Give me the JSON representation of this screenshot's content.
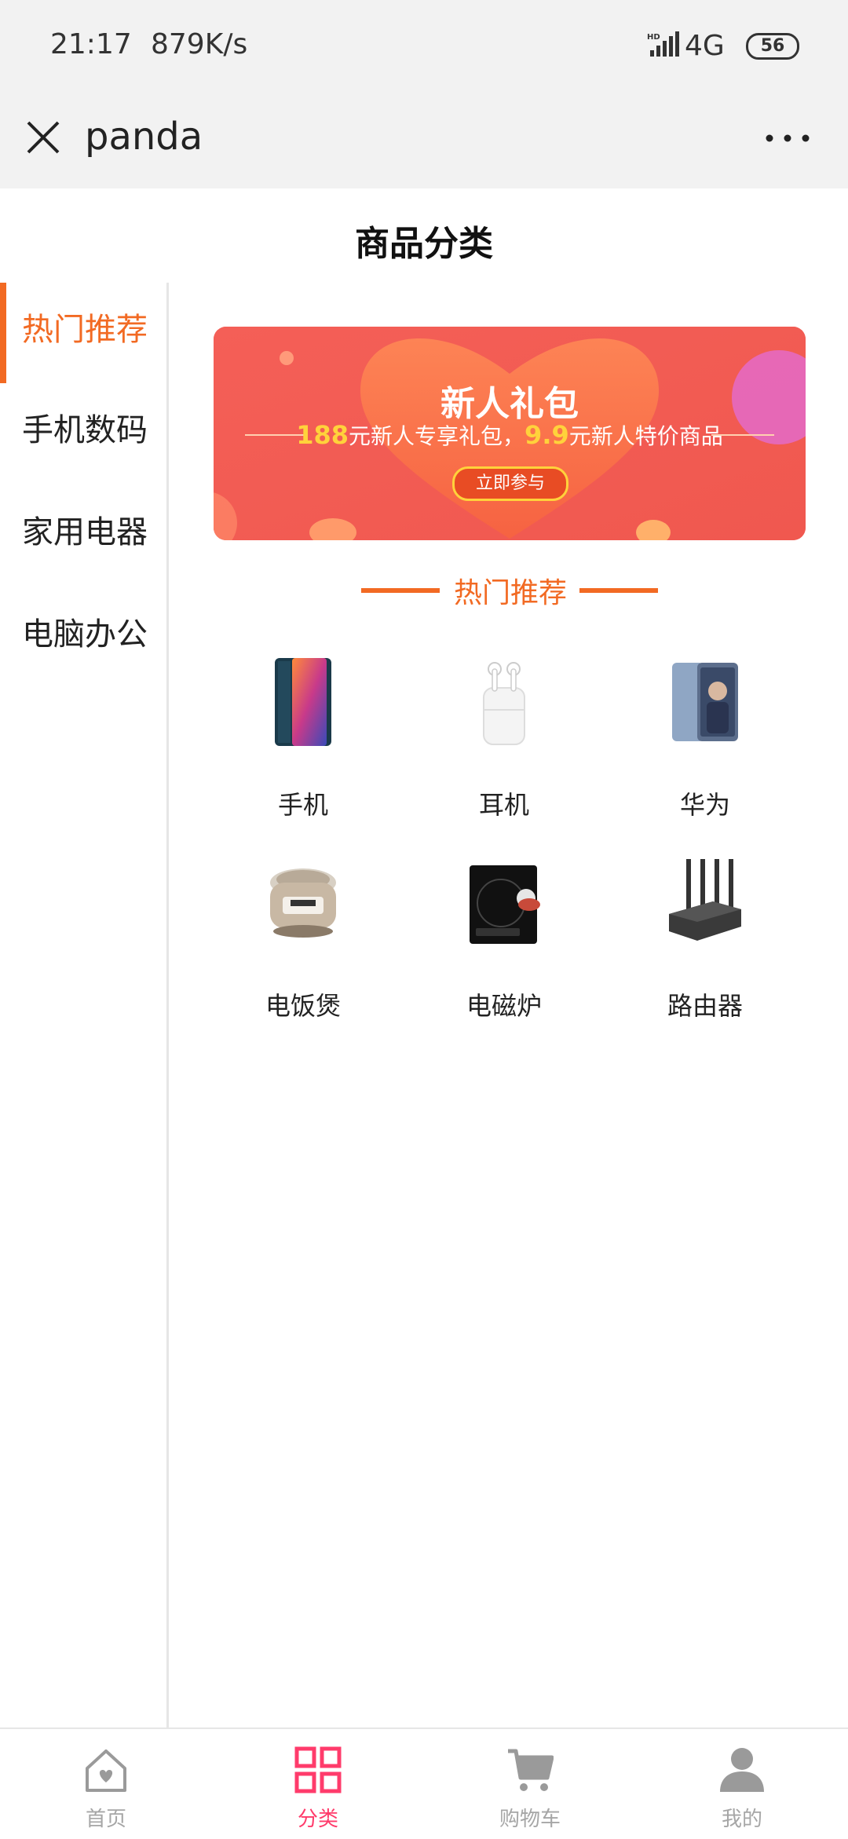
{
  "status_bar": {
    "time": "21:17",
    "speed": "879K/s",
    "network": "4G",
    "battery": "56"
  },
  "nav": {
    "title": "panda"
  },
  "page": {
    "title": "商品分类"
  },
  "sidebar": {
    "items": [
      {
        "label": "热门推荐",
        "active": true
      },
      {
        "label": "手机数码",
        "active": false
      },
      {
        "label": "家用电器",
        "active": false
      },
      {
        "label": "电脑办公",
        "active": false
      }
    ]
  },
  "banner": {
    "title": "新人礼包",
    "amount1": "188",
    "text1": "元新人专享礼包，",
    "amount2": "9.9",
    "text2": "元新人特价商品",
    "cta": "立即参与"
  },
  "section": {
    "title": "热门推荐"
  },
  "products": [
    {
      "label": "手机",
      "icon": "phone-icon"
    },
    {
      "label": "耳机",
      "icon": "earphones-icon"
    },
    {
      "label": "华为",
      "icon": "huawei-phone-icon"
    },
    {
      "label": "电饭煲",
      "icon": "rice-cooker-icon"
    },
    {
      "label": "电磁炉",
      "icon": "induction-cooker-icon"
    },
    {
      "label": "路由器",
      "icon": "router-icon"
    }
  ],
  "tabbar": {
    "items": [
      {
        "label": "首页",
        "icon": "home-icon",
        "active": false
      },
      {
        "label": "分类",
        "icon": "category-icon",
        "active": true
      },
      {
        "label": "购物车",
        "icon": "cart-icon",
        "active": false
      },
      {
        "label": "我的",
        "icon": "user-icon",
        "active": false
      }
    ]
  },
  "colors": {
    "accent": "#f26a23",
    "tab_active": "#ff3b6b",
    "banner_bg": "#f25c54"
  }
}
